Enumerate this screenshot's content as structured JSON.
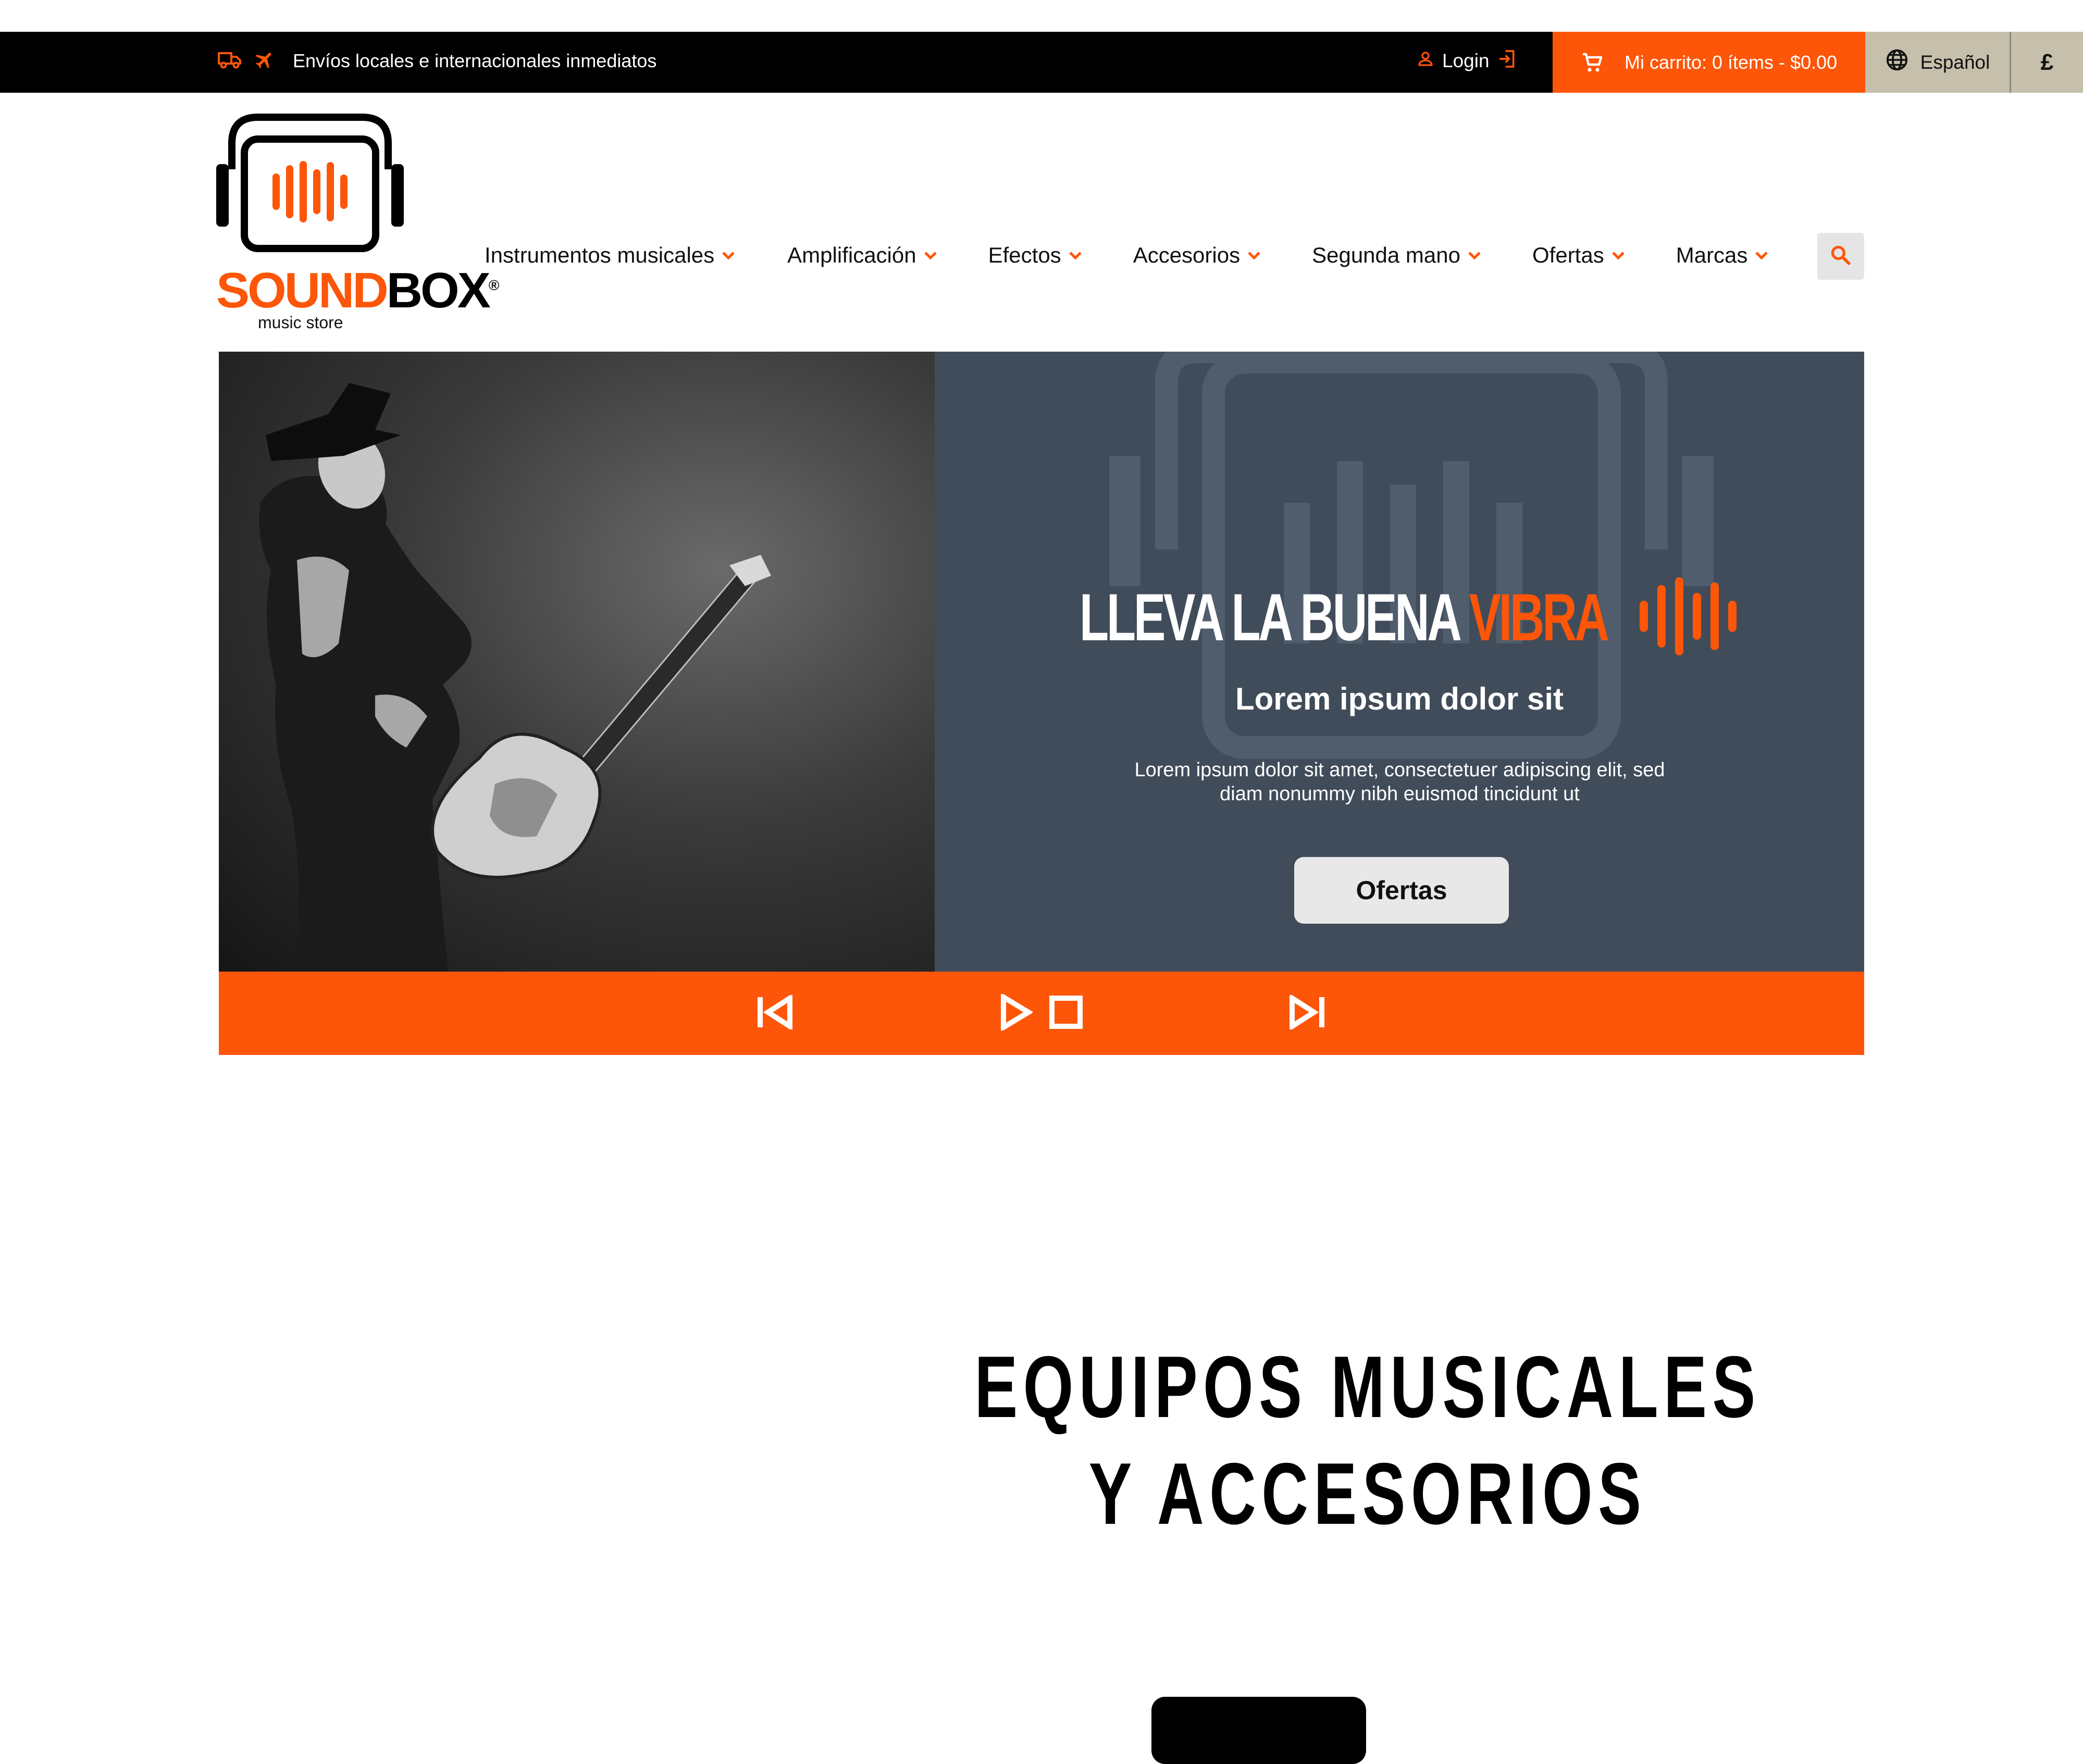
{
  "colors": {
    "accent": "#fd5609",
    "topbar": "#000000",
    "panel": "#404c5a",
    "lang_bg": "#c5bfab",
    "cta_bg": "#e8e8e8"
  },
  "topbar": {
    "shipping_text": "Envíos locales e internacionales inmediatos",
    "shipping_icons": [
      "truck-icon",
      "airplane-icon"
    ],
    "login_label": "Login",
    "cart_label": "Mi carrito: 0 ítems - $0.00",
    "language_label": "Español",
    "currency_symbol": "£"
  },
  "brand": {
    "name_part1": "SOUND",
    "name_part2": "BOX",
    "registered": "®",
    "tagline": "music store"
  },
  "nav": {
    "items": [
      {
        "label": "Instrumentos musicales"
      },
      {
        "label": "Amplificación"
      },
      {
        "label": "Efectos"
      },
      {
        "label": "Accesorios"
      },
      {
        "label": "Segunda mano"
      },
      {
        "label": "Ofertas"
      },
      {
        "label": "Marcas"
      }
    ],
    "search_icon": "search-icon"
  },
  "hero": {
    "headline_part1": "LLEVA LA BUENA ",
    "headline_accent": "VIBRA",
    "subtitle": "Lorem ipsum dolor sit",
    "body": "Lorem ipsum dolor sit amet, consectetuer adipiscing elit, sed diam nonummy nibh euismod tincidunt ut",
    "cta_label": "Ofertas",
    "controls": [
      "previous-icon",
      "play-icon",
      "stop-icon",
      "next-icon"
    ]
  },
  "section": {
    "title_line1": "EQUIPOS MUSICALES",
    "title_line2": "Y ACCESORIOS"
  }
}
